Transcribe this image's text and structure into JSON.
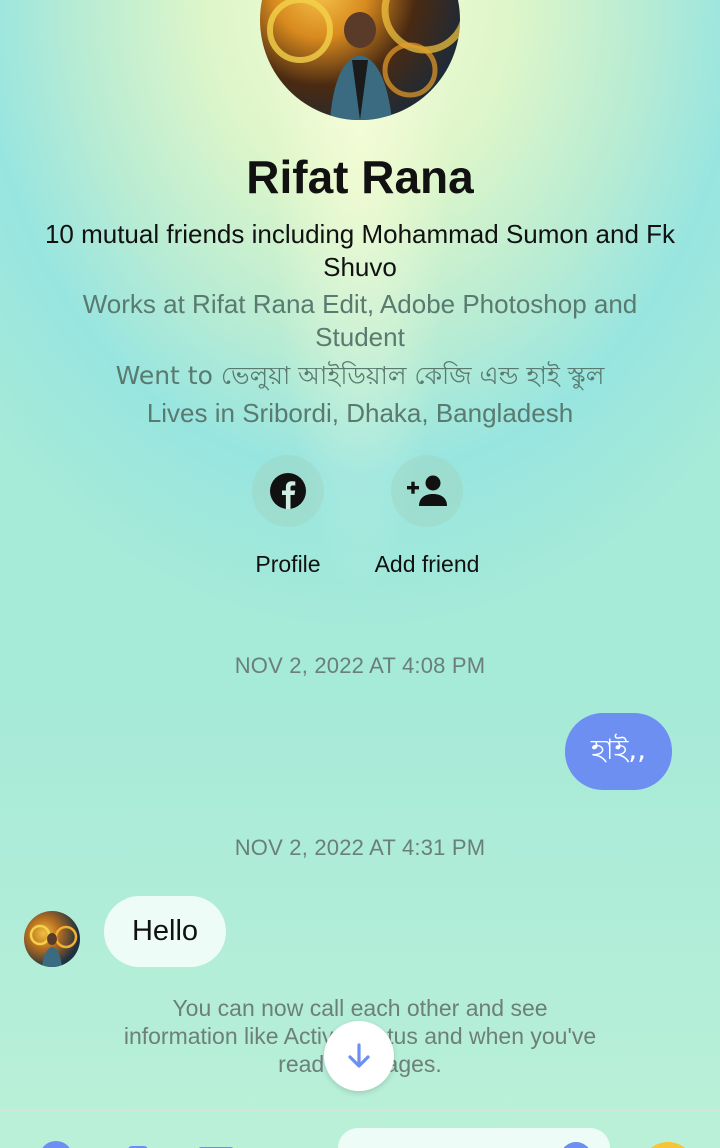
{
  "profile": {
    "name": "Rifat Rana",
    "mutual_friends": "10 mutual friends including Mohammad Sumon and Fk Shuvo",
    "work": "Works at Rifat Rana Edit, Adobe Photoshop and Student",
    "education": "Went to ভেলুয়া আইডিয়াল কেজি এন্ড হাই স্কুল",
    "lives": "Lives in Sribordi, Dhaka, Bangladesh"
  },
  "actions": {
    "profile_label": "Profile",
    "add_friend_label": "Add friend"
  },
  "messages": {
    "timestamp_1": "NOV 2, 2022 AT 4:08 PM",
    "outgoing_1": "হাই,,",
    "timestamp_2": "NOV 2, 2022 AT 4:31 PM",
    "incoming_1": "Hello"
  },
  "notice": "You can now call each other and see information like Active Status and when you've read messages.",
  "colors": {
    "outgoing_bubble": "#6d8ff2",
    "incoming_bubble": "#eefcf7",
    "accent": "#6d8ff2"
  }
}
